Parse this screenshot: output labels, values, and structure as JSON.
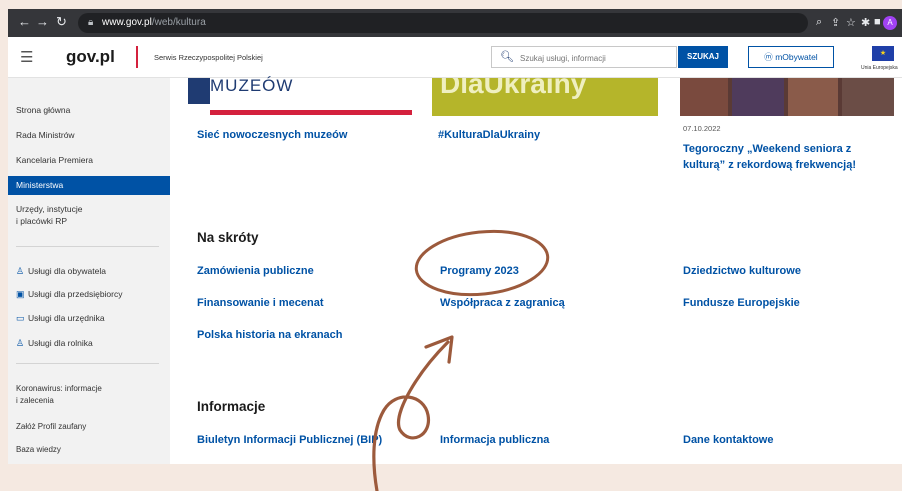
{
  "browser": {
    "url_host": "www.gov.pl",
    "url_path": "/web/kultura",
    "profile_initial": "A"
  },
  "header": {
    "logo": "gov.pl",
    "service_name": "Serwis Rzeczypospolitej Polskiej",
    "search_placeholder": "Szukaj usługi, informacji",
    "search_button": "SZUKAJ",
    "mobywatel": "mObywatel",
    "eu_label": "Unia Europejska"
  },
  "sidebar": {
    "items": [
      {
        "label": "Strona główna"
      },
      {
        "label": "Rada Ministrów"
      },
      {
        "label": "Kancelaria Premiera"
      },
      {
        "label": "Ministerstwa",
        "active": true
      },
      {
        "label": "Urzędy, instytucje\ni placówki RP"
      }
    ],
    "services": [
      {
        "label": "Usługi dla obywatela",
        "icon": "person-icon"
      },
      {
        "label": "Usługi dla przedsiębiorcy",
        "icon": "briefcase-icon"
      },
      {
        "label": "Usługi dla urzędnika",
        "icon": "monitor-icon"
      },
      {
        "label": "Usługi dla rolnika",
        "icon": "person-icon"
      }
    ],
    "extra": [
      {
        "label": "Koronawirus: informacje\ni zalecenia"
      },
      {
        "label": "Załóż Profil zaufany"
      },
      {
        "label": "Baza wiedzy"
      }
    ]
  },
  "main": {
    "banner_muzeow_text": "MUZEÓW",
    "banner_ukraina_text": "DlaUkrainy",
    "top_links": [
      "Sieć nowoczesnych muzeów",
      "#KulturaDlaUkrainy"
    ],
    "news": {
      "date": "07.10.2022",
      "title": "Tegoroczny „Weekend seniora z\nkulturą” z rekordową frekwencją!"
    },
    "shortcuts": {
      "heading": "Na skróty",
      "links": [
        "Zamówienia publiczne",
        "Programy 2023",
        "Dziedzictwo kulturowe",
        "Finansowanie i mecenat",
        "Współpraca z zagranicą",
        "Fundusze Europejskie",
        "Polska historia na ekranach"
      ]
    },
    "info": {
      "heading": "Informacje",
      "links": [
        "Biuletyn Informacji Publicznej (BIP)",
        "Informacja publiczna",
        "Dane kontaktowe"
      ]
    }
  },
  "colors": {
    "brand_blue": "#0052a5",
    "gov_red": "#d4213d",
    "annotation_brown": "#9c5a3c",
    "page_bg": "#f5e9e1"
  }
}
